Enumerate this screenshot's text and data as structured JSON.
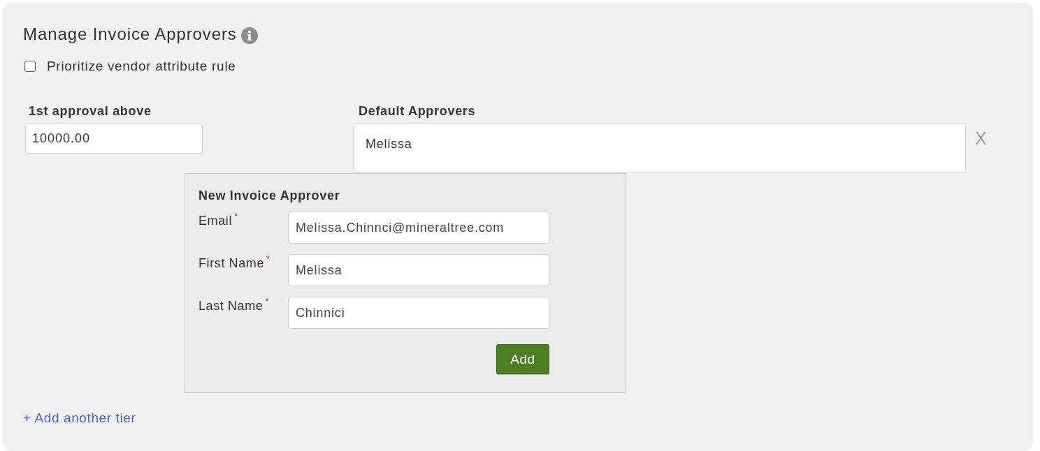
{
  "title": "Manage Invoice Approvers",
  "options": [
    {
      "label": "Prioritize vendor attribute rule",
      "checked": false
    }
  ],
  "tiers": [
    {
      "amount_label": "1st approval above",
      "amount": "10000.00",
      "approvers_label": "Default Approvers",
      "approvers": [
        "Melissa"
      ],
      "remove": "X"
    }
  ],
  "new_approver": {
    "title": "New Invoice Approver",
    "fields": [
      {
        "label": "Email",
        "required_mark": "*",
        "value": "Melissa.Chinnci@mineraltree.com"
      },
      {
        "label": "First Name",
        "required_mark": "*",
        "value": "Melissa"
      },
      {
        "label": "Last Name",
        "required_mark": "*",
        "value": "Chinnici"
      }
    ],
    "button": "Add"
  },
  "add_tier_link": "+ Add another tier"
}
